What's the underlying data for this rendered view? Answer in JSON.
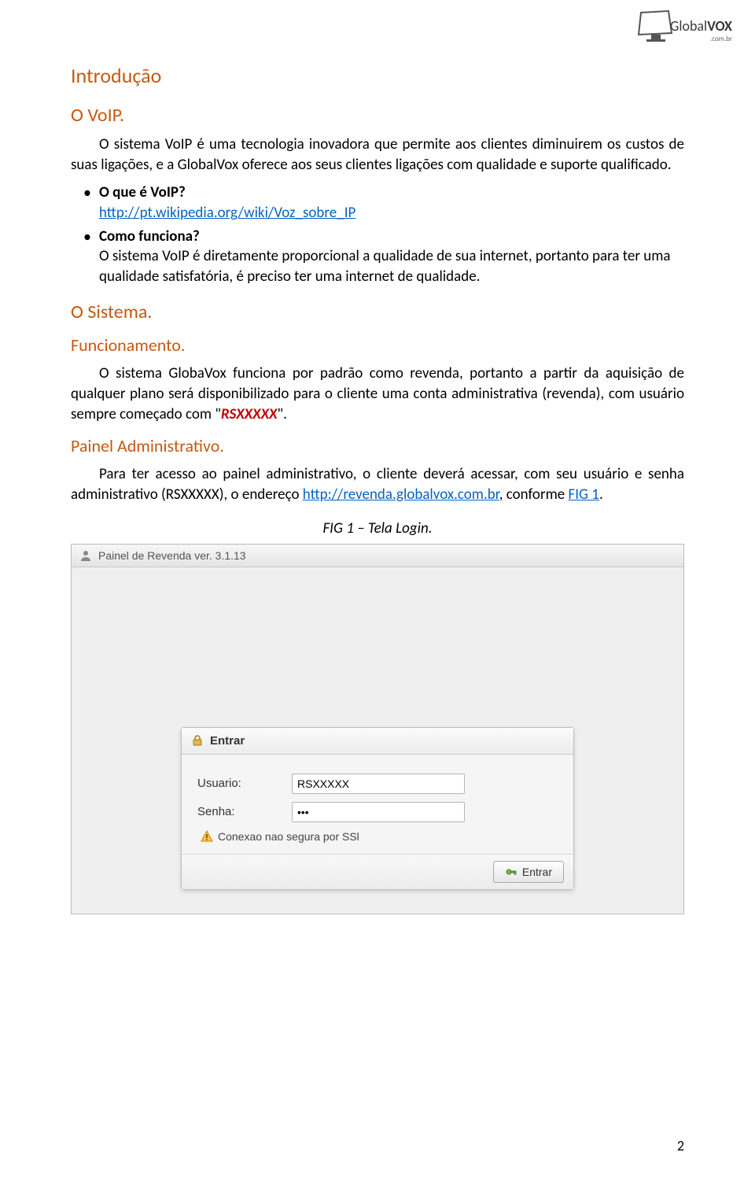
{
  "logo": {
    "brand_prefix": "Global",
    "brand_bold": "VOX",
    "suffix": ".com.br"
  },
  "headings": {
    "intro": "Introdução",
    "ovoip": "O VoIP.",
    "sistema": "O Sistema.",
    "funcionamento": "Funcionamento.",
    "painel": "Painel Administrativo."
  },
  "paragraphs": {
    "p1": "O sistema VoIP é uma tecnologia inovadora que permite aos clientes diminuirem os custos de suas ligações, e a GlobalVox oferece aos seus clientes ligações com qualidade e suporte qualificado.",
    "bullet1": "O que é VoIP?",
    "bullet1_link": "http://pt.wikipedia.org/wiki/Voz_sobre_IP",
    "bullet2": "Como funciona?",
    "bullet2_text": "O sistema VoIP é diretamente proporcional a qualidade de sua internet, portanto para ter uma qualidade satisfatória, é preciso ter uma internet de qualidade.",
    "func_pre": "O sistema GlobaVox funciona por padrão como revenda, portanto a partir da  aquisição de qualquer plano será disponibilizado para o cliente uma conta administrativa (revenda), com usuário sempre começado com \"",
    "func_rs": "RSXXXXX",
    "func_post": "\".",
    "painel_pre": "Para ter acesso ao painel administrativo, o cliente deverá acessar, com seu usuário e senha administrativo (RSXXXXX), o endereço ",
    "painel_link": "http://revenda.globalvox.com.br",
    "painel_mid": ", conforme ",
    "painel_fig": "FIG 1",
    "painel_end": "."
  },
  "fig_caption": "FIG 1 – Tela Login.",
  "login": {
    "window_title": "Painel de Revenda ver. 3.1.13",
    "box_title": "Entrar",
    "label_user": "Usuario:",
    "label_pass": "Senha:",
    "value_user": "RSXXXXX",
    "value_pass": "•••",
    "ssl_msg": "Conexao nao segura por SSl",
    "btn": "Entrar"
  },
  "page_number": "2"
}
